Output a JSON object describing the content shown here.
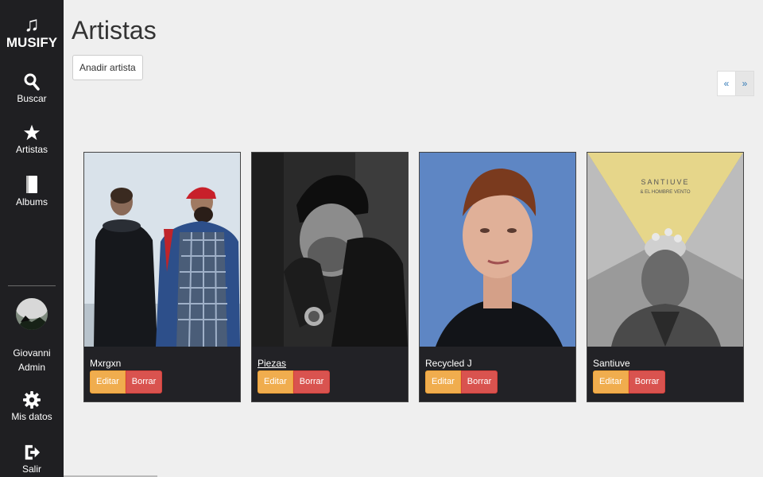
{
  "brand": {
    "name": "MUSIFY"
  },
  "nav": {
    "search": "Buscar",
    "artists": "Artistas",
    "albums": "Albums",
    "my_data": "Mis datos",
    "logout": "Salir"
  },
  "user": {
    "first": "Giovanni",
    "role": "Admin"
  },
  "page": {
    "title": "Artistas",
    "add_label": "Anadir artista",
    "prev": "«",
    "next": "»"
  },
  "artists": [
    {
      "name": "Mxrgxn",
      "edit": "Editar",
      "delete": "Borrar"
    },
    {
      "name": "Piezas",
      "edit": "Editar",
      "delete": "Borrar"
    },
    {
      "name": "Recycled J",
      "edit": "Editar",
      "delete": "Borrar"
    },
    {
      "name": "Santiuve",
      "edit": "Editar",
      "delete": "Borrar"
    }
  ],
  "cover_texts": {
    "santiuve_title": "SANTIUVE",
    "santiuve_sub": "& EL HOMBRE VENTO"
  },
  "colors": {
    "sidebar": "#1f1f22",
    "edit": "#f0ad4e",
    "delete": "#d9534f",
    "card": "#222226"
  },
  "icons": {
    "brand": "music-note-icon",
    "search": "search-icon",
    "artists": "star-icon",
    "albums": "book-icon",
    "my_data": "gear-icon",
    "logout": "logout-icon"
  }
}
